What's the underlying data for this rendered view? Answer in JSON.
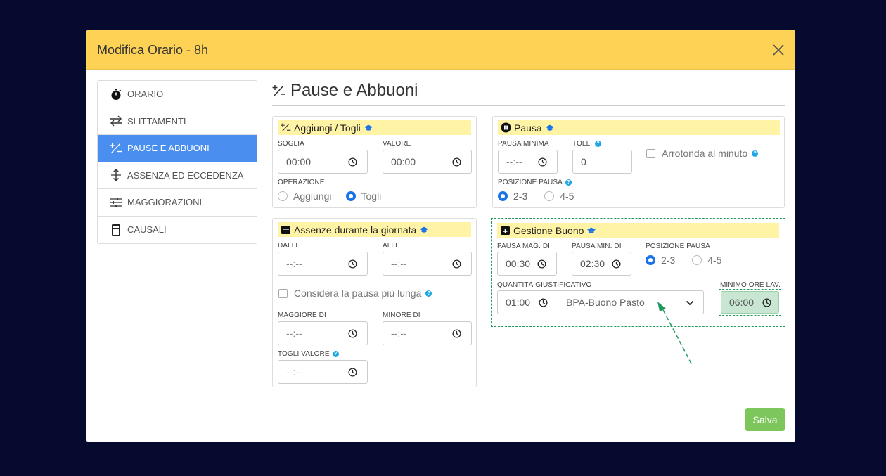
{
  "modal": {
    "title": "Modifica Orario - 8h"
  },
  "sidebar": {
    "items": [
      {
        "label": "ORARIO",
        "icon": "stopwatch-icon",
        "active": false
      },
      {
        "label": "SLITTAMENTI",
        "icon": "swap-arrows-icon",
        "active": false
      },
      {
        "label": "PAUSE E ABBUONI",
        "icon": "plus-minus-icon",
        "active": true
      },
      {
        "label": "ASSENZA ED ECCEDENZA",
        "icon": "vertical-arrows-icon",
        "active": false
      },
      {
        "label": "MAGGIORAZIONI",
        "icon": "sliders-icon",
        "active": false
      },
      {
        "label": "CAUSALI",
        "icon": "calculator-icon",
        "active": false
      }
    ]
  },
  "page": {
    "title": "Pause e Abbuoni"
  },
  "aggiungi": {
    "title": "Aggiungi / Togli",
    "soglia_label": "SOGLIA",
    "soglia_value": "00:00",
    "valore_label": "VALORE",
    "valore_value": "00:00",
    "operazione_label": "OPERAZIONE",
    "opt_aggiungi": "Aggiungi",
    "opt_togli": "Togli",
    "selected": "Togli"
  },
  "pausa": {
    "title": "Pausa",
    "minima_label": "PAUSA MINIMA",
    "minima_value": "--:--",
    "toll_label": "TOLL.",
    "toll_value": "0",
    "arrotonda_label": "Arrotonda al minuto",
    "posizione_label": "POSIZIONE PAUSA",
    "opt_23": "2-3",
    "opt_45": "4-5",
    "selected": "2-3"
  },
  "assenze": {
    "title": "Assenze durante la giornata",
    "dalle_label": "DALLE",
    "dalle_value": "--:--",
    "alle_label": "ALLE",
    "alle_value": "--:--",
    "considera_label": "Considera la pausa più lunga",
    "maggiore_label": "MAGGIORE DI",
    "maggiore_value": "--:--",
    "minore_label": "MINORE DI",
    "minore_value": "--:--",
    "togli_label": "TOGLI VALORE",
    "togli_value": "--:--"
  },
  "buono": {
    "title": "Gestione Buono",
    "mag_label": "PAUSA MAG. DI",
    "mag_value": "00:30",
    "min_label": "PAUSA MIN. DI",
    "min_value": "02:30",
    "posizione_label": "POSIZIONE PAUSA",
    "opt_23": "2-3",
    "opt_45": "4-5",
    "selected": "2-3",
    "quantita_label": "QUANTITÀ GIUSTIFICATIVO",
    "quantita_value": "01:00",
    "giustificativo_value": "BPA-Buono Pasto",
    "minimo_label": "MINIMO ORE LAV.",
    "minimo_value": "06:00"
  },
  "footer": {
    "save_label": "Salva"
  },
  "colors": {
    "header": "#fdd255",
    "active": "#4a8fef",
    "save": "#7cc65c",
    "highlight": "#fff3a6",
    "annotation": "#1f9a5c"
  }
}
